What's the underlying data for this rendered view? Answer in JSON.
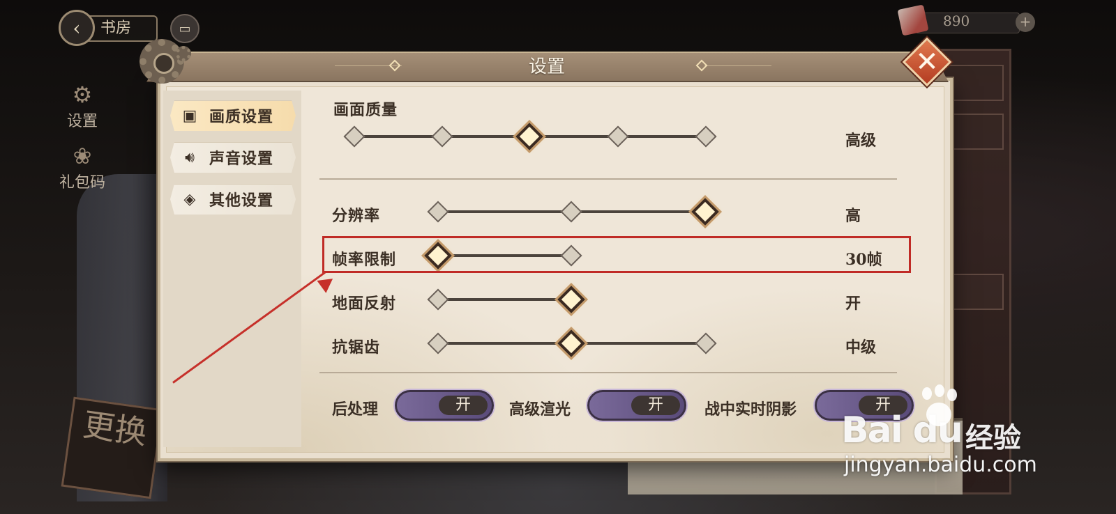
{
  "topbar": {
    "back_icon": "back-arrow-icon",
    "location_label": "书房",
    "chat_icon": "chat-icon",
    "currency_value": "890",
    "currency_plus": "+"
  },
  "side_menu": {
    "items": [
      {
        "label": "设置",
        "icon": "gear-icon"
      },
      {
        "label": "礼包码",
        "icon": "gift-icon"
      }
    ]
  },
  "background": {
    "plaque_text": "更换"
  },
  "dialog": {
    "title": "设置",
    "close_icon": "close-icon",
    "tabs": [
      {
        "label": "画质设置",
        "icon": "picture-icon",
        "active": true
      },
      {
        "label": "声音设置",
        "icon": "speaker-icon",
        "active": false
      },
      {
        "label": "其他设置",
        "icon": "layers-icon",
        "active": false
      }
    ],
    "settings": [
      {
        "label": "画面质量",
        "value": "高级",
        "steps": 5,
        "selected": 3
      },
      {
        "label": "分辨率",
        "value": "高",
        "steps": 3,
        "selected": 3
      },
      {
        "label": "帧率限制",
        "value": "30帧",
        "steps": 2,
        "selected": 1
      },
      {
        "label": "地面反射",
        "value": "开",
        "steps": 2,
        "selected": 2
      },
      {
        "label": "抗锯齿",
        "value": "中级",
        "steps": 3,
        "selected": 2
      }
    ],
    "toggles": [
      {
        "label": "后处理",
        "state": "开"
      },
      {
        "label": "高级渲光",
        "state": "开"
      },
      {
        "label": "战中实时阴影",
        "state": "开"
      }
    ]
  },
  "annotation": {
    "highlight_color": "#c02b26"
  },
  "watermark": {
    "brand": "Bai du",
    "product": "经验",
    "url": "jingyan.baidu.com"
  }
}
